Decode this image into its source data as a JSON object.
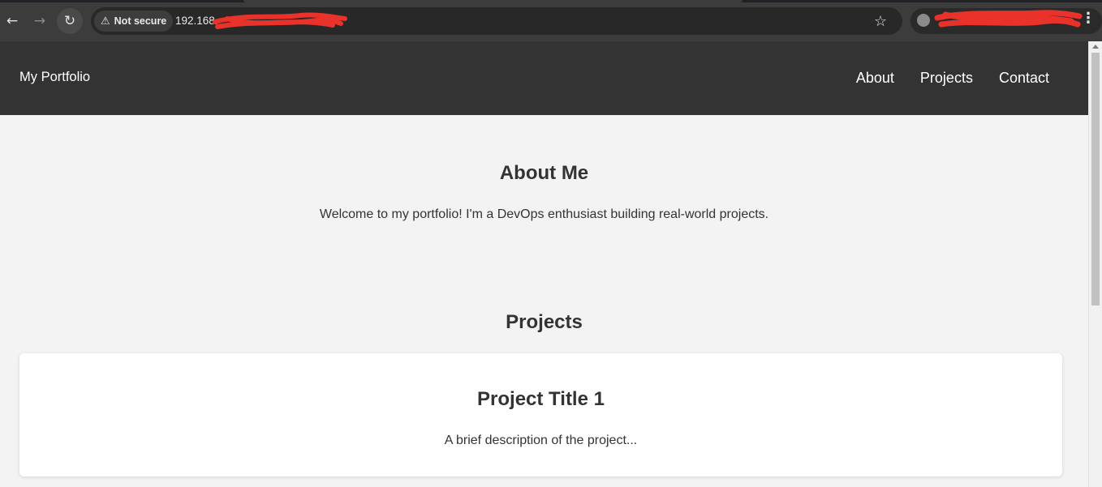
{
  "browser": {
    "security_label": "Not secure",
    "url": "192.168."
  },
  "site": {
    "brand": "My Portfolio",
    "nav": [
      "About",
      "Projects",
      "Contact"
    ]
  },
  "about": {
    "heading": "About Me",
    "text": "Welcome to my portfolio! I'm a DevOps enthusiast building real-world projects."
  },
  "projects": {
    "heading": "Projects",
    "items": [
      {
        "title": "Project Title 1",
        "description": "A brief description of the project..."
      }
    ]
  },
  "colors": {
    "header_bg": "#333333",
    "page_bg": "#f3f3f3",
    "card_bg": "#ffffff",
    "redaction": "#e8322a"
  }
}
